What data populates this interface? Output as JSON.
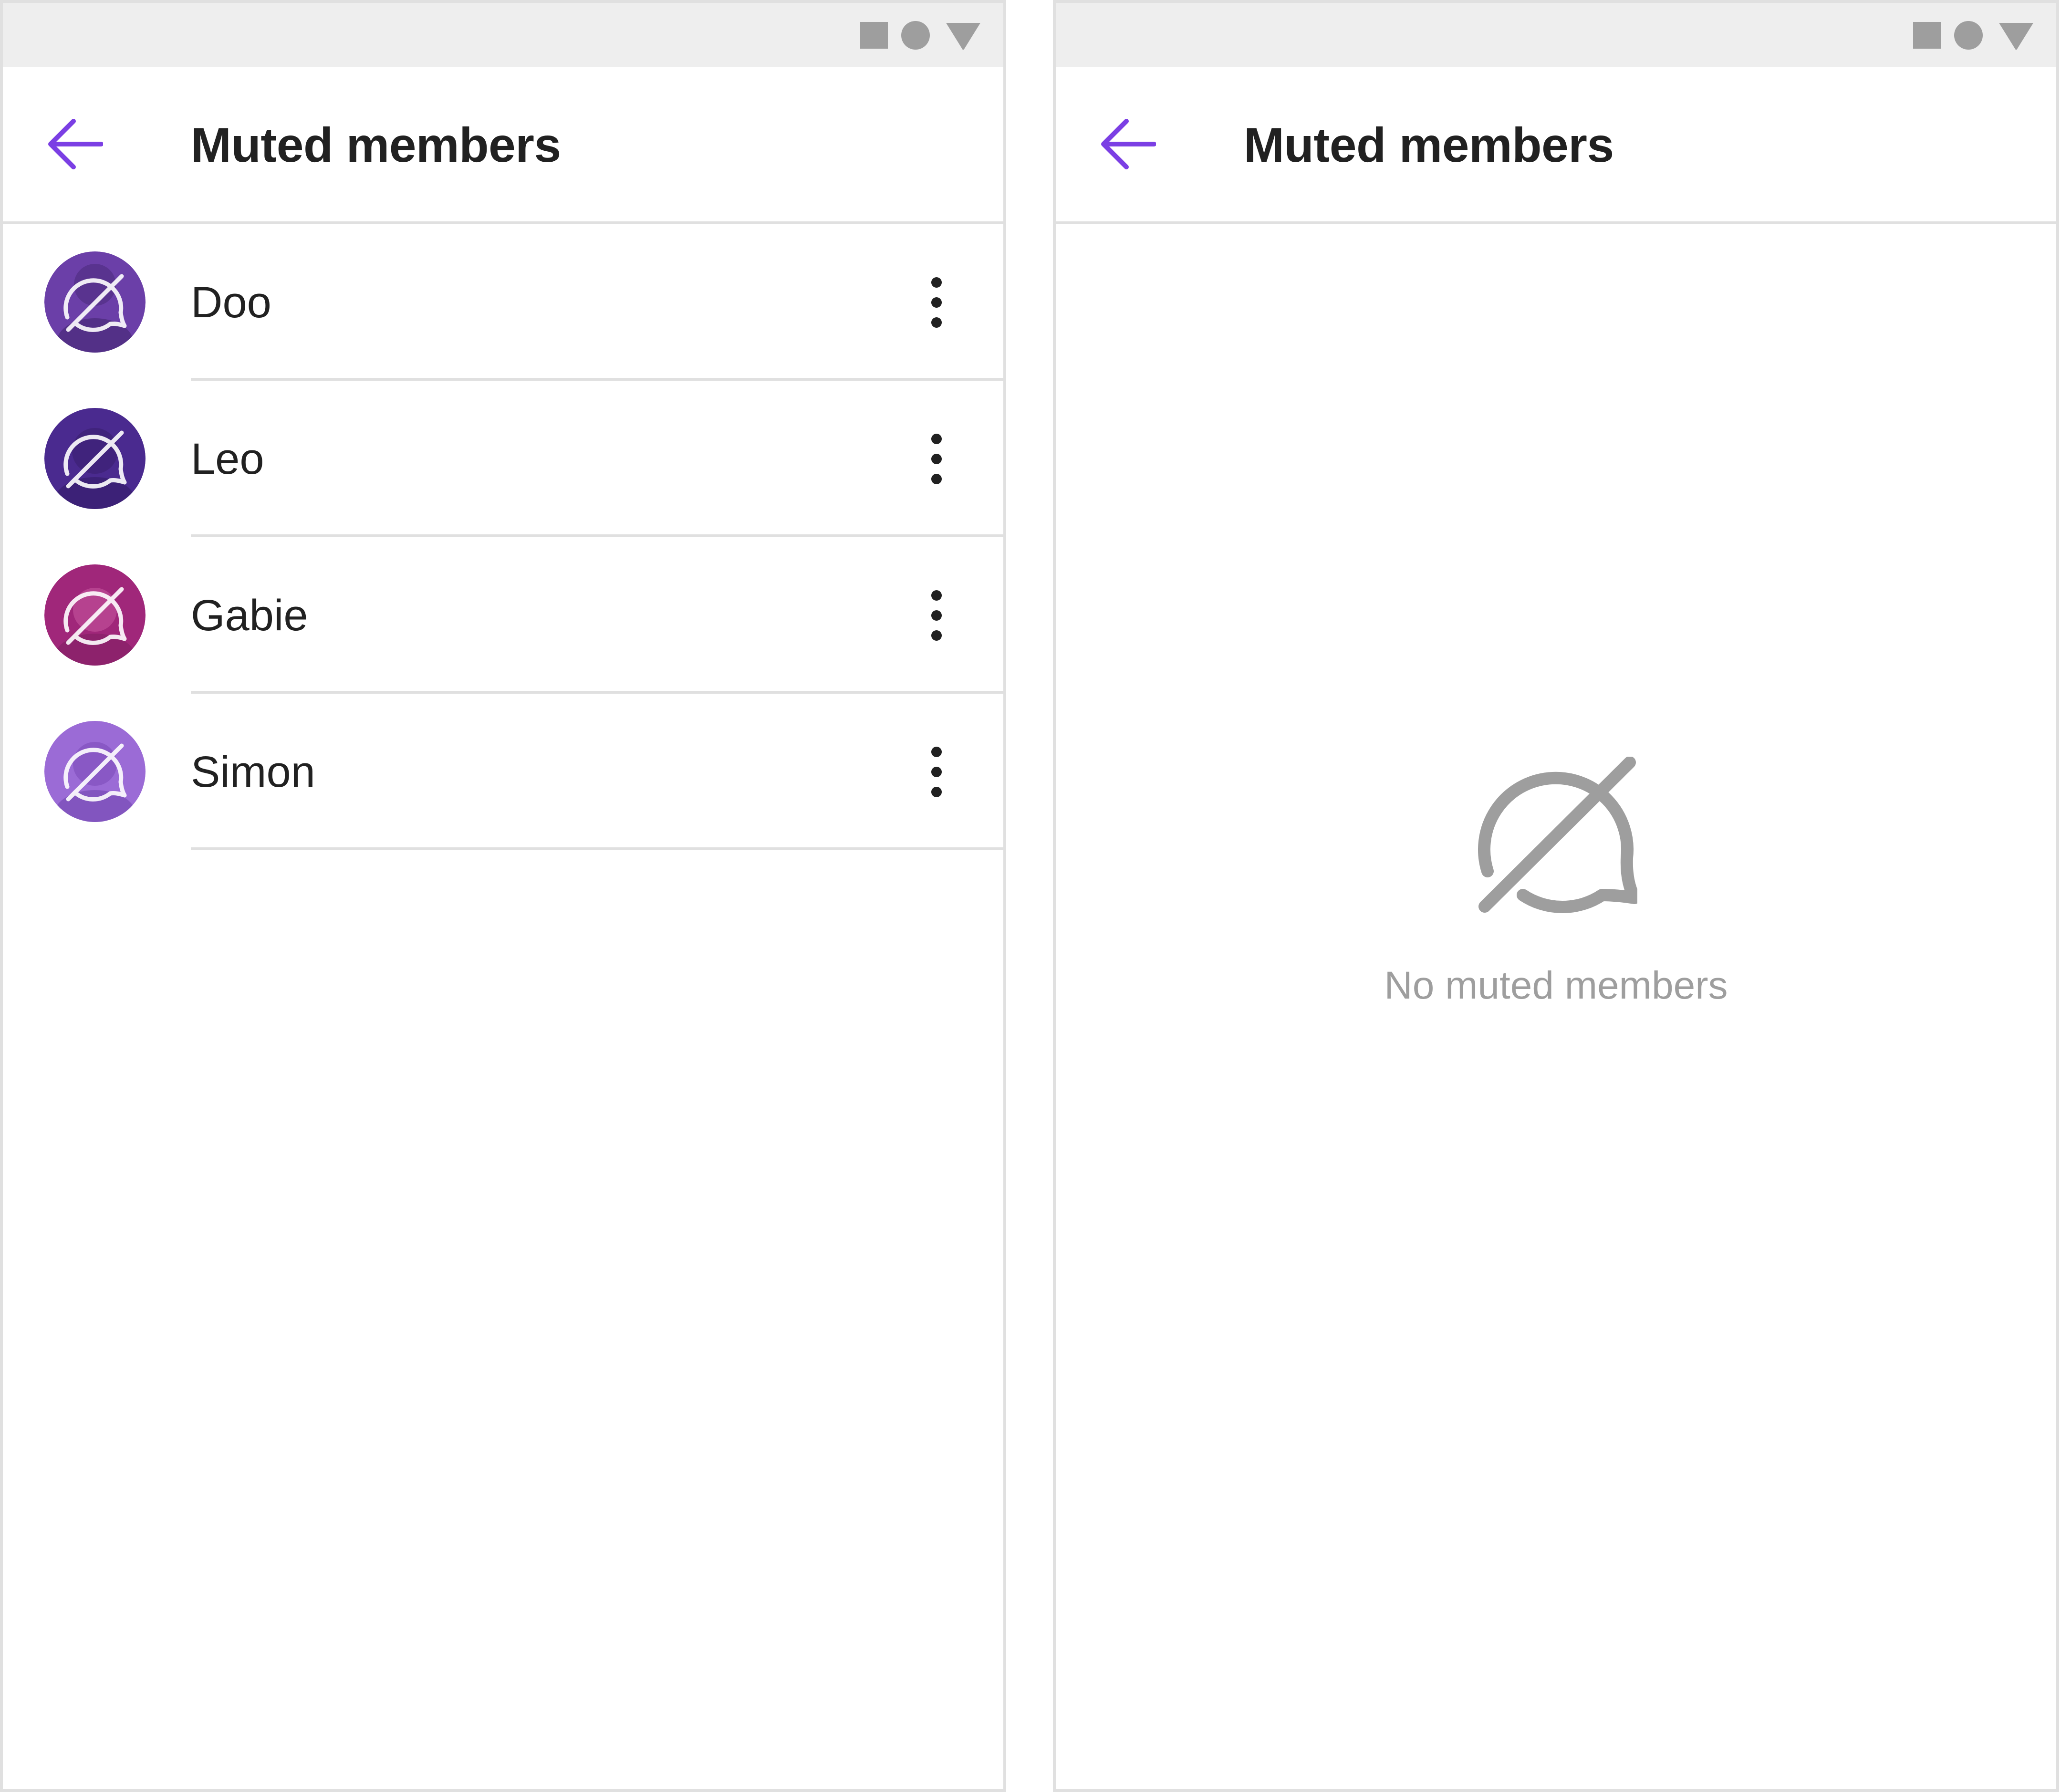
{
  "colors": {
    "accent": "#7b3fe4",
    "status_bar_bg": "#eeeeee",
    "status_icon": "#9e9e9e",
    "title_text": "#212121",
    "divider": "#e0e0e0",
    "empty_text": "#9e9e9e"
  },
  "status_bar": {
    "icons": [
      "square-icon",
      "circle-icon",
      "triangle-icon"
    ]
  },
  "screen_list": {
    "app_bar": {
      "back_icon": "arrow-left-icon",
      "title": "Muted members"
    },
    "members": [
      {
        "name": "Doo",
        "avatar_color": "#6b3fa8",
        "avatar_icon": "muted-chat-icon",
        "menu_icon": "more-vertical-icon"
      },
      {
        "name": "Leo",
        "avatar_color": "#4a2a8f",
        "avatar_icon": "muted-chat-icon",
        "menu_icon": "more-vertical-icon"
      },
      {
        "name": "Gabie",
        "avatar_color": "#a0277a",
        "avatar_icon": "muted-chat-icon",
        "menu_icon": "more-vertical-icon"
      },
      {
        "name": "Simon",
        "avatar_color": "#9b6bd6",
        "avatar_icon": "muted-chat-icon",
        "menu_icon": "more-vertical-icon"
      }
    ]
  },
  "screen_empty": {
    "app_bar": {
      "back_icon": "arrow-left-icon",
      "title": "Muted members"
    },
    "empty_state": {
      "icon": "muted-chat-icon",
      "text": "No muted members"
    }
  }
}
